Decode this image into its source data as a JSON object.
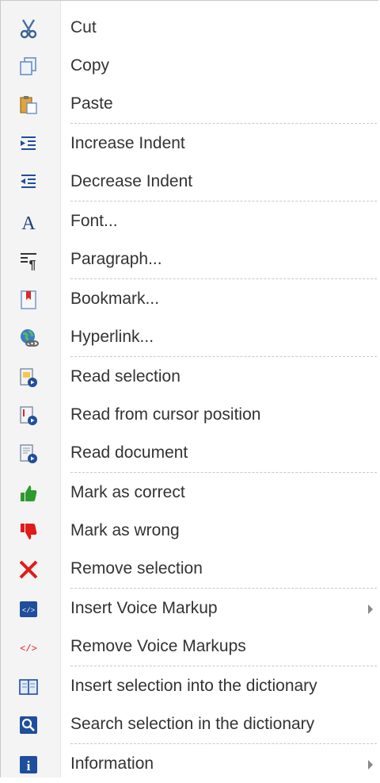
{
  "menu": {
    "items": [
      {
        "label": "Cut",
        "icon": "scissors-icon",
        "has_submenu": false,
        "separator_after": false
      },
      {
        "label": "Copy",
        "icon": "copy-icon",
        "has_submenu": false,
        "separator_after": false
      },
      {
        "label": "Paste",
        "icon": "paste-icon",
        "has_submenu": false,
        "separator_after": true
      },
      {
        "label": "Increase Indent",
        "icon": "increase-indent-icon",
        "has_submenu": false,
        "separator_after": false
      },
      {
        "label": "Decrease Indent",
        "icon": "decrease-indent-icon",
        "has_submenu": false,
        "separator_after": true
      },
      {
        "label": "Font...",
        "icon": "font-icon",
        "has_submenu": false,
        "separator_after": false
      },
      {
        "label": "Paragraph...",
        "icon": "paragraph-icon",
        "has_submenu": false,
        "separator_after": true
      },
      {
        "label": "Bookmark...",
        "icon": "bookmark-icon",
        "has_submenu": false,
        "separator_after": false
      },
      {
        "label": "Hyperlink...",
        "icon": "hyperlink-icon",
        "has_submenu": false,
        "separator_after": true
      },
      {
        "label": "Read selection",
        "icon": "read-selection-icon",
        "has_submenu": false,
        "separator_after": false
      },
      {
        "label": "Read from cursor position",
        "icon": "read-from-cursor-icon",
        "has_submenu": false,
        "separator_after": false
      },
      {
        "label": "Read document",
        "icon": "read-document-icon",
        "has_submenu": false,
        "separator_after": true
      },
      {
        "label": "Mark as correct",
        "icon": "thumbs-up-icon",
        "has_submenu": false,
        "separator_after": false
      },
      {
        "label": "Mark as wrong",
        "icon": "thumbs-down-icon",
        "has_submenu": false,
        "separator_after": false
      },
      {
        "label": "Remove selection",
        "icon": "red-x-icon",
        "has_submenu": false,
        "separator_after": true
      },
      {
        "label": "Insert Voice Markup",
        "icon": "voice-markup-icon",
        "has_submenu": true,
        "separator_after": false
      },
      {
        "label": "Remove Voice Markups",
        "icon": "remove-markup-icon",
        "has_submenu": false,
        "separator_after": true
      },
      {
        "label": "Insert selection into the dictionary",
        "icon": "dictionary-book-icon",
        "has_submenu": false,
        "separator_after": false
      },
      {
        "label": "Search selection in the dictionary",
        "icon": "search-dictionary-icon",
        "has_submenu": false,
        "separator_after": true
      },
      {
        "label": "Information",
        "icon": "info-icon",
        "has_submenu": true,
        "separator_after": false
      }
    ],
    "colors": {
      "text": "#333333",
      "gutter": "#f4f4f4",
      "separator": "#c8c8c8",
      "icon_blue": "#1f4e9c",
      "icon_green": "#2e9a2e",
      "icon_red": "#e01b1b"
    }
  }
}
